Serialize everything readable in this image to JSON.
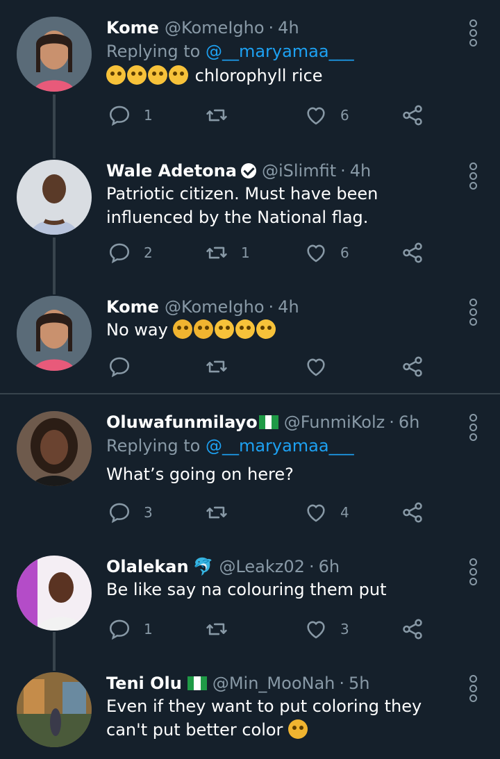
{
  "replying_prefix": "Replying to ",
  "tweets": [
    {
      "name": "Kome",
      "handle": "@KomeIgho",
      "sep": "·",
      "time": "4h",
      "replying_to": "@__maryamaa___",
      "text": "chlorophyll rice",
      "replies": "1",
      "retweets": "",
      "likes": "6"
    },
    {
      "name": "Wale Adetona",
      "handle": "@iSlimfit",
      "sep": "·",
      "time": "4h",
      "text": "Patriotic citizen. Must have been influenced by the National flag.",
      "replies": "2",
      "retweets": "1",
      "likes": "6"
    },
    {
      "name": "Kome",
      "handle": "@KomeIgho",
      "sep": "·",
      "time": "4h",
      "text": "No way",
      "replies": "",
      "retweets": "",
      "likes": ""
    },
    {
      "name": "Oluwafunmilayo",
      "handle": "@FunmiKolz",
      "sep": "·",
      "time": "6h",
      "replying_to": "@__maryamaa___",
      "text": "What’s going on here?",
      "replies": "3",
      "retweets": "",
      "likes": "4"
    },
    {
      "name": "Olalekan",
      "handle": "@Leakz02",
      "sep": "·",
      "time": "6h",
      "text": "Be like say na colouring them put",
      "replies": "1",
      "retweets": "",
      "likes": "3"
    },
    {
      "name": "Teni Olu",
      "handle": "@Min_MooNah",
      "sep": "·",
      "time": "5h",
      "text": "Even if they want to put coloring they can't put better color",
      "replies": "",
      "retweets": "",
      "likes": ""
    }
  ],
  "colors": {
    "background": "#15202b",
    "secondary_text": "#8899a6",
    "link": "#1da1f2",
    "divider": "#38444d"
  },
  "icons": [
    "reply-icon",
    "retweet-icon",
    "like-icon",
    "share-icon",
    "more-options-icon",
    "verified-badge-icon",
    "nigeria-flag-emoji",
    "dolphin-emoji",
    "laughing-emoji",
    "crying-emoji"
  ]
}
